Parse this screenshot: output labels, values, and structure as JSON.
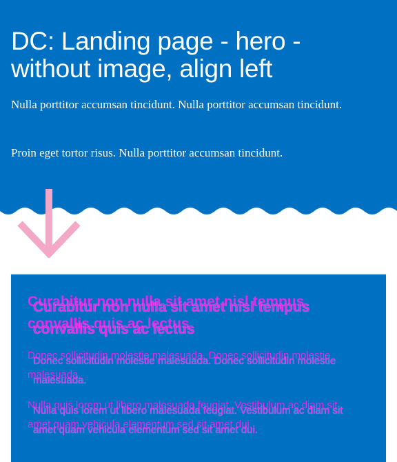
{
  "hero": {
    "title": "DC: Landing page - hero - without image, align left",
    "paragraph_1": "Nulla porttitor accumsan tincidunt. Nulla porttitor accumsan tincidunt.",
    "paragraph_2": "Proin eget tortor risus. Nulla porttitor accumsan tincidunt."
  },
  "content_box": {
    "heading": "Curabitur non nulla sit amet nisl tempus convallis quis ac lectus",
    "paragraph_1": "Donec sollicitudin molestie malesuada. Donec sollicitudin molestie malesuada.",
    "paragraph_2": "Nulla quis lorem ut libero malesuada feugiat. Vestibulum ac diam sit amet quam vehicula elementum sed sit amet dui."
  },
  "colors": {
    "hero_background": "#0070c3",
    "hero_text": "#ffffff",
    "arrow": "#f4a8c8",
    "box_text": "#e32be8"
  },
  "icons": {
    "arrow": "arrow-down-icon"
  }
}
